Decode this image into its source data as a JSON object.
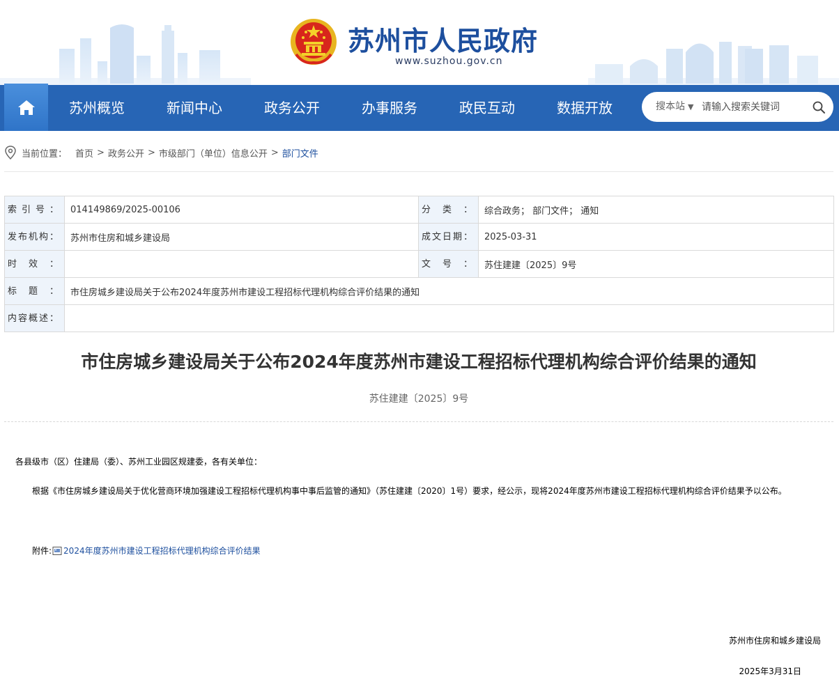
{
  "header": {
    "site_name": "苏州市人民政府",
    "site_domain": "www.suzhou.gov.cn",
    "emblem_icon": "national-emblem-icon"
  },
  "nav": {
    "home_icon": "home-icon",
    "items": [
      {
        "label": "苏州概览"
      },
      {
        "label": "新闻中心"
      },
      {
        "label": "政务公开"
      },
      {
        "label": "办事服务"
      },
      {
        "label": "政民互动"
      },
      {
        "label": "数据开放"
      }
    ],
    "search": {
      "scope": "搜本站",
      "placeholder": "请输入搜索关键词"
    }
  },
  "breadcrumb": {
    "prefix": "当前位置：",
    "items": [
      "首页",
      "政务公开",
      "市级部门（单位）信息公开",
      "部门文件"
    ]
  },
  "meta": {
    "index_label": "索引号：",
    "index_value": "014149869/2025-00106",
    "category_label": "分类：",
    "category_value": "综合政务； 部门文件； 通知",
    "publisher_label": "发布机构：",
    "publisher_value": "苏州市住房和城乡建设局",
    "created_label": "成文日期：",
    "created_value": "2025-03-31",
    "validity_label": "时效：",
    "validity_value": "",
    "docno_label": "文号：",
    "docno_value": "苏住建建〔2025〕9号",
    "title_label": "标题：",
    "title_value": "市住房城乡建设局关于公布2024年度苏州市建设工程招标代理机构综合评价结果的通知",
    "summary_label": "内容概述：",
    "summary_value": ""
  },
  "article": {
    "title": "市住房城乡建设局关于公布2024年度苏州市建设工程招标代理机构综合评价结果的通知",
    "doc_no": "苏住建建〔2025〕9号",
    "greeting": "各县级市（区）住建局（委）、苏州工业园区规建委，各有关单位：",
    "paragraph": "根据《市住房城乡建设局关于优化营商环境加强建设工程招标代理机构事中事后监管的通知》（苏住建建〔2020〕1号）要求，经公示，现将2024年度苏州市建设工程招标代理机构综合评价结果予以公布。",
    "attachment_prefix": "附件:",
    "attachment_link": "2024年度苏州市建设工程招标代理机构综合评价结果",
    "sign_org": "苏州市住房和城乡建设局",
    "sign_date": "2025年3月31日"
  },
  "colors": {
    "nav_bg": "#2765b5",
    "brand_blue": "#1d4f9e",
    "meta_key_bg": "#eef4fb"
  }
}
